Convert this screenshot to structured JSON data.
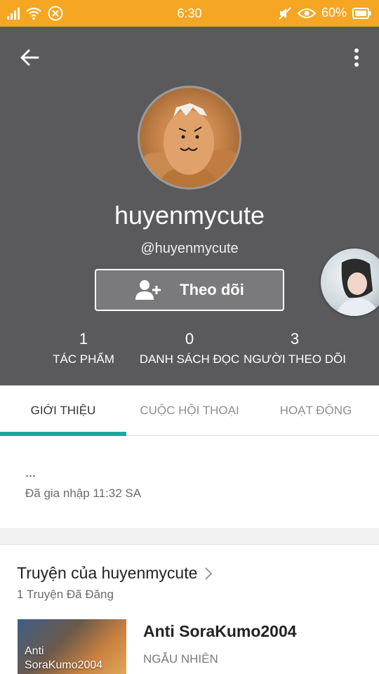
{
  "status_bar": {
    "time": "6:30",
    "battery": "60%",
    "icons": [
      "signal-icon",
      "wifi-icon",
      "app-icon",
      "mute-icon",
      "eye-icon",
      "battery-icon"
    ]
  },
  "profile": {
    "username": "huyenmycute",
    "handle": "@huyenmycute",
    "follow_label": "Theo dõi",
    "stats": [
      {
        "value": "1",
        "label": "TÁC PHẨM"
      },
      {
        "value": "0",
        "label": "DANH SÁCH ĐỌC"
      },
      {
        "value": "3",
        "label": "NGƯỜI THEO DÕI"
      }
    ]
  },
  "tabs": [
    {
      "label": "GIỚI THIỆU",
      "active": true
    },
    {
      "label": "CUỘC HỘI THOẠI",
      "active": false
    },
    {
      "label": "HOẠT ĐỘNG",
      "active": false
    }
  ],
  "about": {
    "description": "...",
    "joined": "Đã gia nhập 11:32 SA"
  },
  "stories": {
    "title": "Truyện của huyenmycute",
    "subtitle": "1 Truyện Đã Đăng",
    "items": [
      {
        "cover_text_1": "Anti",
        "cover_text_2": "SoraKumo2004",
        "title": "Anti SoraKumo2004",
        "genre": "NGẪU NHIÊN"
      }
    ]
  },
  "colors": {
    "status_bar": "#f5a623",
    "header": "#5a5a5c",
    "tab_indicator": "#1aa7a0"
  }
}
